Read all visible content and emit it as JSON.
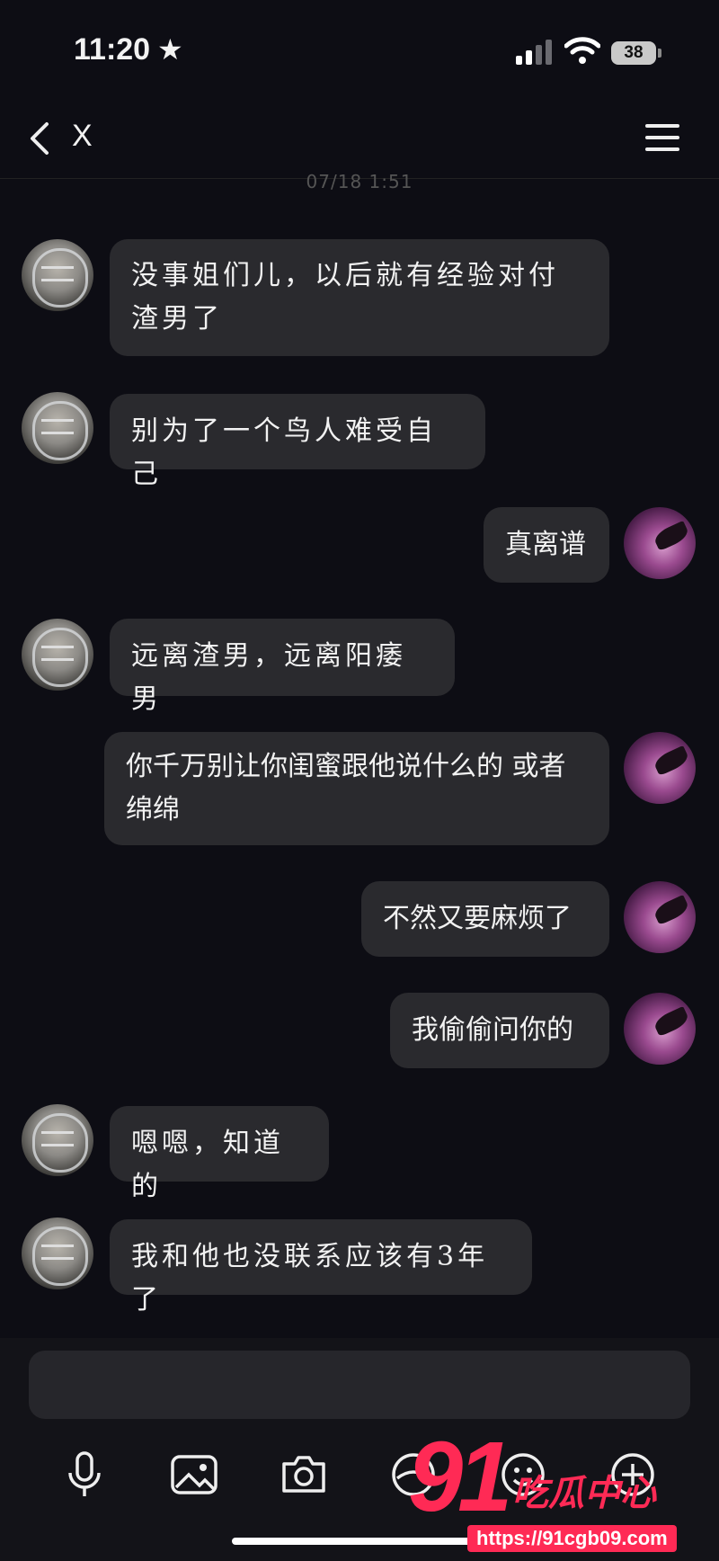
{
  "status_bar": {
    "time": "11:20",
    "star": "★",
    "battery": "38"
  },
  "nav": {
    "title": "X",
    "back_icon": "chevron-left-icon",
    "menu_icon": "hamburger-icon"
  },
  "timestamp": "07/18 1:51",
  "messages": [
    {
      "sender": "friend",
      "text": "没事姐们儿，以后就有经验对付渣男了"
    },
    {
      "sender": "friend",
      "text": "别为了一个鸟人难受自己"
    },
    {
      "sender": "me",
      "text": "真离谱"
    },
    {
      "sender": "friend",
      "text": "远离渣男，远离阳痿男"
    },
    {
      "sender": "me",
      "text": "你千万别让你闺蜜跟他说什么的 或者绵绵"
    },
    {
      "sender": "me",
      "text": "不然又要麻烦了"
    },
    {
      "sender": "me",
      "text": "我偷偷问你的"
    },
    {
      "sender": "friend",
      "text": "嗯嗯，知道的"
    },
    {
      "sender": "friend",
      "text": "我和他也没联系应该有3年了"
    }
  ],
  "input": {
    "placeholder": ""
  },
  "toolbar": [
    "mic-icon",
    "image-icon",
    "camera-icon",
    "sticker-icon",
    "emoji-icon",
    "plus-icon"
  ],
  "watermark": {
    "logo": "91",
    "text": "吃瓜中心",
    "url": "https://91cgb09.com"
  },
  "colors": {
    "background": "#0d0d14",
    "bubble": "#2a2a2e",
    "watermark": "#ff2a55"
  }
}
